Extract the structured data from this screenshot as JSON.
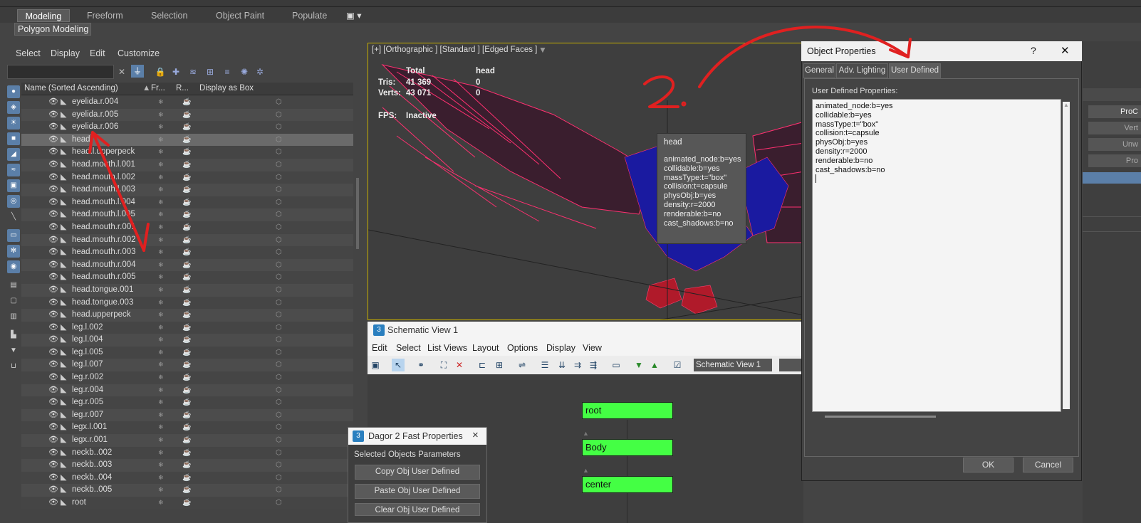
{
  "ribbon": {
    "tabs": [
      "Modeling",
      "Freeform",
      "Selection",
      "Object Paint",
      "Populate"
    ],
    "sub": "Polygon Modeling"
  },
  "scene_explorer": {
    "menu": [
      "Select",
      "Display",
      "Edit",
      "Customize"
    ],
    "columns": [
      "Name (Sorted Ascending)",
      "Fr...",
      "R...",
      "Display as Box"
    ],
    "rows": [
      "eyelida.r.004",
      "eyelida.r.005",
      "eyelida.r.006",
      "head",
      "head.l.upperpeck",
      "head.mouth.l.001",
      "head.mouth.l.002",
      "head.mouth.l.003",
      "head.mouth.l.004",
      "head.mouth.l.005",
      "head.mouth.r.001",
      "head.mouth.r.002",
      "head.mouth.r.003",
      "head.mouth.r.004",
      "head.mouth.r.005",
      "head.tongue.001",
      "head.tongue.003",
      "head.upperpeck",
      "leg.l.002",
      "leg.l.004",
      "leg.l.005",
      "leg.l.007",
      "leg.r.002",
      "leg.r.004",
      "leg.r.005",
      "leg.r.007",
      "legx.l.001",
      "legx.r.001",
      "neckb..002",
      "neckb..003",
      "neckb..004",
      "neckb..005",
      "root"
    ],
    "selected_row": "head"
  },
  "viewport": {
    "label": "[+] [Orthographic ] [Standard ] [Edged Faces ]",
    "stats": {
      "col_total": "Total",
      "col_head": "head",
      "tris_label": "Tris:",
      "tris_total": "41 369",
      "tris_head": "0",
      "verts_label": "Verts:",
      "verts_total": "43 071",
      "verts_head": "0",
      "fps_label": "FPS:",
      "fps_value": "Inactive"
    },
    "tooltip": {
      "title": "head",
      "lines": [
        "animated_node:b=yes",
        "collidable:b=yes",
        "massType:t=\"box\"",
        "collision:t=capsule",
        "physObj:b=yes",
        "density:r=2000",
        "renderable:b=no",
        "cast_shadows:b=no"
      ]
    }
  },
  "schematic": {
    "title": "Schematic View 1",
    "menu": [
      "Edit",
      "Select",
      "List Views",
      "Layout",
      "Options",
      "Display",
      "View"
    ],
    "name_field": "Schematic View 1",
    "nodes": [
      "root",
      "Body",
      "center"
    ]
  },
  "dagor": {
    "title": "Dagor 2 Fast Properties",
    "section": "Selected Objects Parameters",
    "buttons": [
      "Copy Obj User Defined",
      "Paste Obj User Defined",
      "Clear Obj User Defined"
    ],
    "close": "×"
  },
  "object_properties": {
    "title": "Object Properties",
    "help": "?",
    "close": "✕",
    "tabs": [
      "General",
      "Adv. Lighting",
      "User Defined"
    ],
    "active_tab": "User Defined",
    "label": "User Defined Properties:",
    "lines": [
      "animated_node:b=yes",
      "collidable:b=yes",
      "massType:t=\"box\"",
      "collision:t=capsule",
      "physObj:b=yes",
      "density:r=2000",
      "renderable:b=no",
      "cast_shadows:b=no"
    ],
    "ok": "OK",
    "cancel": "Cancel"
  },
  "right_panel": {
    "buttons": [
      "ProC",
      "Vert",
      "Unw",
      "Pro"
    ]
  },
  "annotations": {
    "note": "2.",
    "color": "#e02020"
  }
}
